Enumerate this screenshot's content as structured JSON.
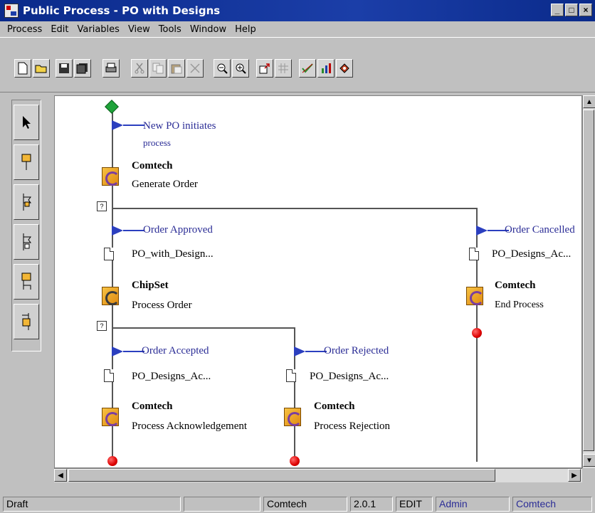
{
  "window": {
    "title": "Public Process - PO with Designs",
    "controls": [
      "_",
      "□",
      "×"
    ]
  },
  "menu": [
    "Process",
    "Edit",
    "Variables",
    "View",
    "Tools",
    "Window",
    "Help"
  ],
  "toolbar": {
    "buttons": [
      "new-icon",
      "open-icon",
      "save-icon",
      "save-all-icon",
      "print-icon",
      "cut-icon",
      "copy-icon",
      "paste-icon",
      "delete-icon",
      "zoom-out-icon",
      "zoom-in-icon",
      "export-icon",
      "grid-icon",
      "validate-icon",
      "chart-icon",
      "tag-icon"
    ]
  },
  "palette": [
    "pointer-tool-icon",
    "activity-tool-icon",
    "send-tool-icon",
    "receive-tool-icon",
    "branch-tool-icon",
    "end-tool-icon"
  ],
  "diagram": {
    "start_label_1": "New PO initiates",
    "start_label_2": "process",
    "a1_actor": "Comtech",
    "a1_name": "Generate Order",
    "decision_mark": "?",
    "approved": "Order Approved",
    "approved_doc": "PO_with_Design...",
    "a2_actor": "ChipSet",
    "a2_name": "Process Order",
    "cancelled": "Order Cancelled",
    "cancelled_doc": "PO_Designs_Ac...",
    "a3_actor": "Comtech",
    "a3_name": "End Process",
    "accepted": "Order Accepted",
    "accepted_doc": "PO_Designs_Ac...",
    "a4_actor": "Comtech",
    "a4_name": "Process Acknowledgement",
    "rejected": "Order Rejected",
    "rejected_doc": "PO_Designs_Ac...",
    "a5_actor": "Comtech",
    "a5_name": "Process Rejection"
  },
  "status": {
    "mode": "Draft",
    "partner": "Comtech",
    "version": "2.0.1",
    "edit": "EDIT",
    "user": "Admin",
    "org": "Comtech"
  },
  "colors": {
    "titlebar": "#1b3ea8",
    "link_blue": "#2b2d96",
    "start": "#1fa33a",
    "end": "#d00000"
  }
}
